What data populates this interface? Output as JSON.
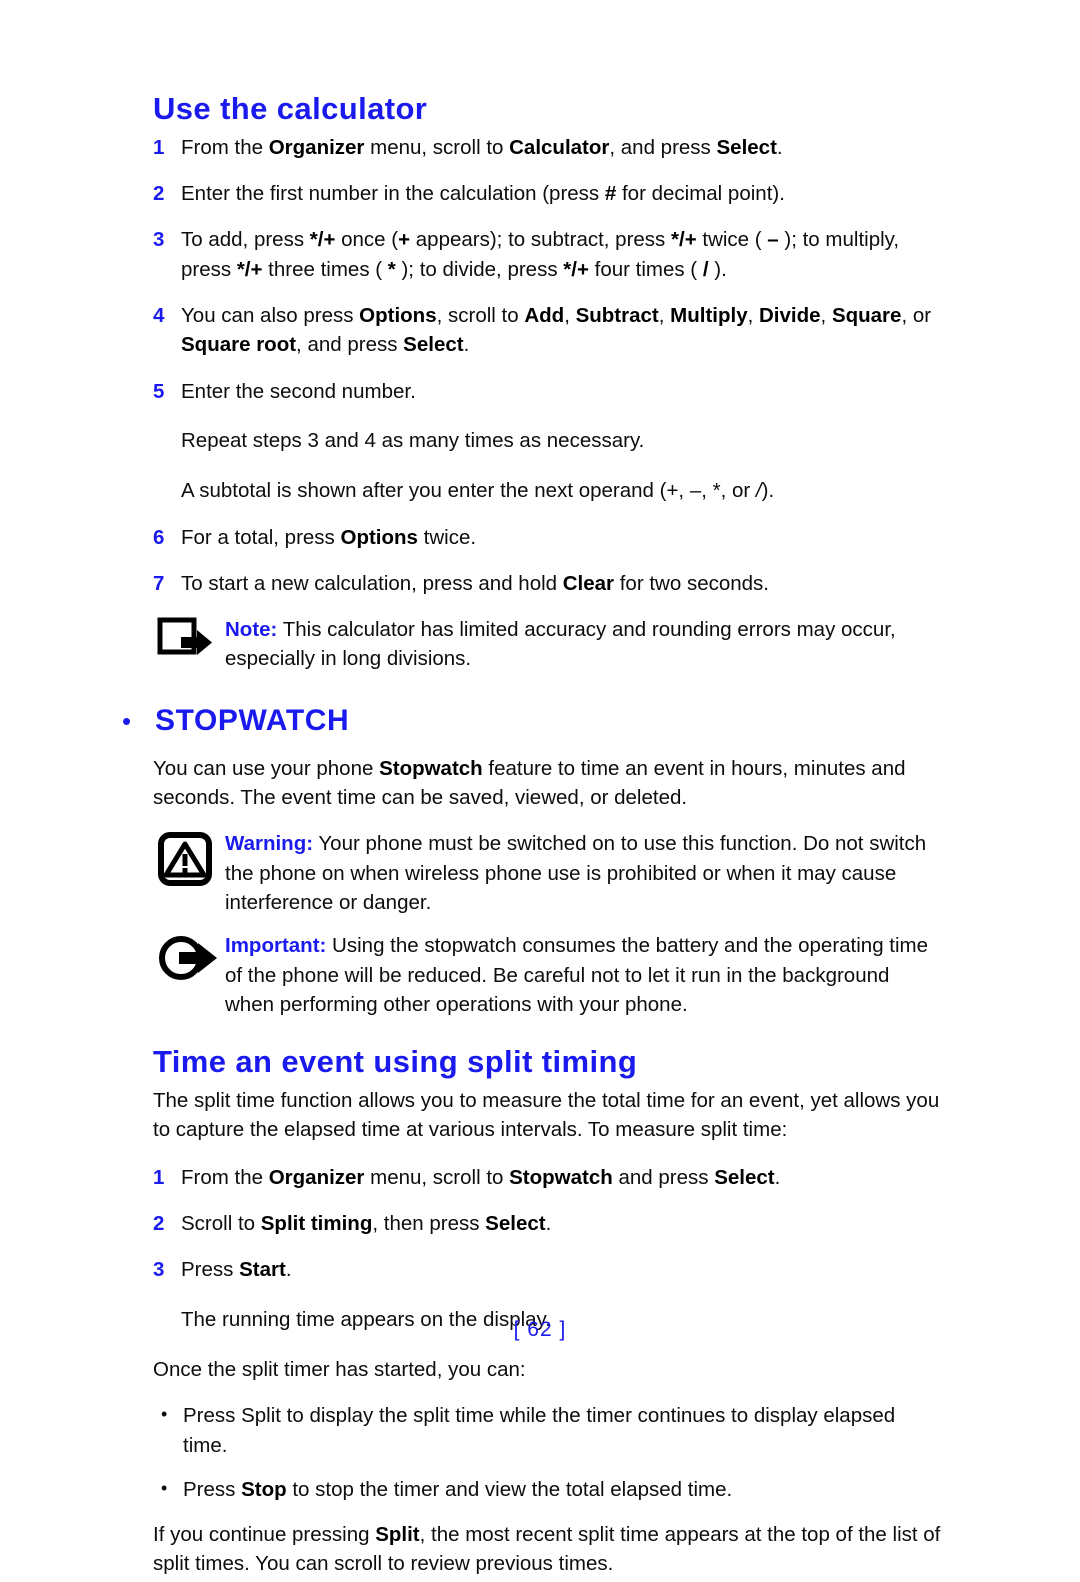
{
  "document": {
    "page_number": "[ 62 ]",
    "accent_color": "#1a1aee",
    "text_color": "#0d0d0d"
  },
  "calculator_section": {
    "heading": "Use the calculator",
    "steps": [
      {
        "num": "1",
        "parts": [
          {
            "t": "From the ",
            "b": false
          },
          {
            "t": "Organizer",
            "b": true
          },
          {
            "t": " menu, scroll to ",
            "b": false
          },
          {
            "t": "Calculator",
            "b": true
          },
          {
            "t": ", and press ",
            "b": false
          },
          {
            "t": "Select",
            "b": true
          },
          {
            "t": ".",
            "b": false
          }
        ]
      },
      {
        "num": "2",
        "parts": [
          {
            "t": "Enter the first number in the calculation (press ",
            "b": false
          },
          {
            "t": "#",
            "b": true
          },
          {
            "t": " for decimal point).",
            "b": false
          }
        ]
      },
      {
        "num": "3",
        "parts": [
          {
            "t": "To add, press ",
            "b": false
          },
          {
            "t": "*/+",
            "b": true
          },
          {
            "t": " once (",
            "b": false
          },
          {
            "t": "+",
            "b": true
          },
          {
            "t": " appears); to subtract, press ",
            "b": false
          },
          {
            "t": "*/+",
            "b": true
          },
          {
            "t": " twice ( ",
            "b": false
          },
          {
            "t": "–",
            "b": true
          },
          {
            "t": " ); to multiply, press ",
            "b": false
          },
          {
            "t": "*/+",
            "b": true
          },
          {
            "t": " three times ( ",
            "b": false
          },
          {
            "t": "*",
            "b": true
          },
          {
            "t": " ); to divide, press ",
            "b": false
          },
          {
            "t": "*/+",
            "b": true
          },
          {
            "t": " four times ( ",
            "b": false
          },
          {
            "t": "/",
            "b": true
          },
          {
            "t": " ).",
            "b": false
          }
        ]
      },
      {
        "num": "4",
        "parts": [
          {
            "t": "You can also press ",
            "b": false
          },
          {
            "t": "Options",
            "b": true
          },
          {
            "t": ", scroll to ",
            "b": false
          },
          {
            "t": "Add",
            "b": true
          },
          {
            "t": ", ",
            "b": false
          },
          {
            "t": "Subtract",
            "b": true
          },
          {
            "t": ", ",
            "b": false
          },
          {
            "t": "Multiply",
            "b": true
          },
          {
            "t": ", ",
            "b": false
          },
          {
            "t": "Divide",
            "b": true
          },
          {
            "t": ", ",
            "b": false
          },
          {
            "t": "Square",
            "b": true
          },
          {
            "t": ", or ",
            "b": false
          },
          {
            "t": "Square root",
            "b": true
          },
          {
            "t": ", and press ",
            "b": false
          },
          {
            "t": "Select",
            "b": true
          },
          {
            "t": ".",
            "b": false
          }
        ]
      },
      {
        "num": "5",
        "parts": [
          {
            "t": "Enter the second number.",
            "b": false
          }
        ]
      }
    ],
    "after_step5": [
      {
        "parts": [
          {
            "t": "Repeat steps 3 and 4 as many times as necessary.",
            "b": false
          }
        ]
      },
      {
        "parts": [
          {
            "t": "A subtotal is shown after you enter the next operand (+, –, *, or ",
            "b": false
          },
          {
            "t": "/",
            "b": false,
            "i": true
          },
          {
            "t": ").",
            "b": false
          }
        ]
      }
    ],
    "steps_tail": [
      {
        "num": "6",
        "parts": [
          {
            "t": "For a total, press ",
            "b": false
          },
          {
            "t": "Options",
            "b": true
          },
          {
            "t": " twice.",
            "b": false
          }
        ]
      },
      {
        "num": "7",
        "parts": [
          {
            "t": "To start a new calculation, press and hold ",
            "b": false
          },
          {
            "t": "Clear",
            "b": true
          },
          {
            "t": " for two seconds.",
            "b": false
          }
        ]
      }
    ],
    "note": {
      "icon": "note-arrow-icon",
      "lead": "Note:",
      "body": " This calculator has limited accuracy and rounding errors may occur, especially in long divisions."
    }
  },
  "stopwatch_section": {
    "bullet": "•",
    "heading": "STOPWATCH",
    "intro_parts": [
      {
        "t": "You can use your phone ",
        "b": false
      },
      {
        "t": "Stopwatch",
        "b": true
      },
      {
        "t": " feature to time an event in hours, minutes and seconds. The event time can be saved, viewed, or deleted.",
        "b": false
      }
    ],
    "warning": {
      "icon": "warning-triangle-icon",
      "lead": "Warning:",
      "body": " Your phone must be switched on to use this function. Do not switch the phone on when wireless phone use is prohibited or when it may cause interference or danger."
    },
    "important": {
      "icon": "important-arrow-icon",
      "lead": "Important:",
      "body": " Using the stopwatch consumes the battery and the operating time of the phone will be reduced. Be careful not to let it run in the background when performing other operations with your phone."
    }
  },
  "split_timing_section": {
    "heading": "Time an event using split timing",
    "intro": "The split time function allows you to measure the total time for an event, yet allows you to capture the elapsed time at various intervals. To measure split time:",
    "steps": [
      {
        "num": "1",
        "parts": [
          {
            "t": "From the ",
            "b": false
          },
          {
            "t": "Organizer",
            "b": true
          },
          {
            "t": " menu, scroll to ",
            "b": false
          },
          {
            "t": "Stopwatch",
            "b": true
          },
          {
            "t": " and press ",
            "b": false
          },
          {
            "t": "Select",
            "b": true
          },
          {
            "t": ".",
            "b": false
          }
        ]
      },
      {
        "num": "2",
        "parts": [
          {
            "t": "Scroll to ",
            "b": false
          },
          {
            "t": "Split timing",
            "b": true
          },
          {
            "t": ", then press ",
            "b": false
          },
          {
            "t": "Select",
            "b": true
          },
          {
            "t": ".",
            "b": false
          }
        ]
      },
      {
        "num": "3",
        "parts": [
          {
            "t": "Press ",
            "b": false
          },
          {
            "t": "Start",
            "b": true
          },
          {
            "t": ".",
            "b": false
          }
        ]
      }
    ],
    "after_step3": "The running time appears on the display.",
    "list_intro": "Once the split timer has started, you can:",
    "bullets": [
      {
        "marker": "•",
        "parts": [
          {
            "t": "Press Split to display the split time while the timer continues to display elapsed time.",
            "b": false
          }
        ]
      },
      {
        "marker": "•",
        "parts": [
          {
            "t": "Press ",
            "b": false
          },
          {
            "t": "Stop",
            "b": true
          },
          {
            "t": " to stop the timer and view the total elapsed time.",
            "b": false
          }
        ]
      }
    ],
    "closing_parts": [
      {
        "t": "If you continue pressing ",
        "b": false
      },
      {
        "t": "Split",
        "b": true
      },
      {
        "t": ", the most recent split time appears at the top of the list of split times. You can scroll to review previous times.",
        "b": false
      }
    ]
  }
}
